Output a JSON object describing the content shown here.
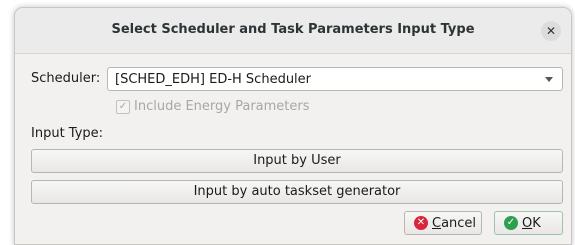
{
  "dialog": {
    "title": "Select Scheduler and Task Parameters Input Type",
    "close_icon": "close-icon"
  },
  "scheduler": {
    "label": "Scheduler:",
    "selected": "[SCHED_EDH] ED-H Scheduler"
  },
  "energy": {
    "label": "Include Energy Parameters",
    "checked": true,
    "enabled": false
  },
  "input_type": {
    "label": "Input Type:",
    "by_user": "Input by User",
    "by_generator": "Input by auto taskset generator"
  },
  "buttons": {
    "cancel_mnemonic": "C",
    "cancel_rest": "ancel",
    "ok_mnemonic": "O",
    "ok_rest": "K"
  },
  "colors": {
    "cancel_icon": "#d8263c",
    "ok_icon": "#2e9e4f"
  }
}
